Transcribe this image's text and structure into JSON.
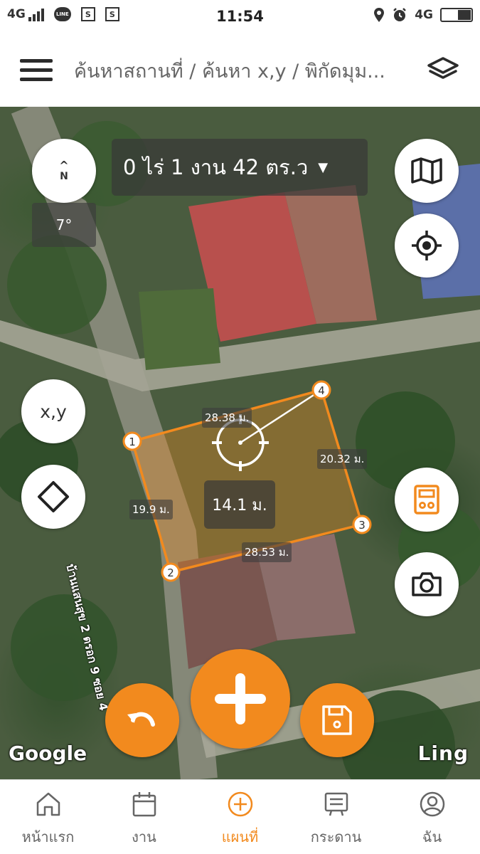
{
  "status_bar": {
    "network_left": "4G",
    "line_label": "LINE",
    "s_icon": "S",
    "time": "11:54",
    "network_right": "4G"
  },
  "header": {
    "title": "ค้นหาสถานที่ / ค้นหา x,y / พิกัดมุม...",
    "menu_icon": "hamburger-icon",
    "layers_icon": "layers-icon"
  },
  "map": {
    "compass_arrow": "^",
    "compass_label": "N",
    "rotation": "7°",
    "area": "0 ไร่ 1 งาน 42 ตร.ว",
    "xy_button": "x,y",
    "edges": [
      "28.38 ม.",
      "20.32 ม.",
      "28.53 ม.",
      "19.9 ม."
    ],
    "center_distance": "14.1 ม.",
    "corner_points": [
      "1",
      "2",
      "3",
      "4"
    ],
    "road_name": "บ้านแสนสุข 2 ตรอก 9 ซอย 4",
    "google_attribution": "Google",
    "provider_logo": "Ling",
    "accent_color": "#F28A1E"
  },
  "bottom_nav": {
    "items": [
      {
        "label": "หน้าแรก",
        "icon": "home-icon",
        "active": false
      },
      {
        "label": "งาน",
        "icon": "clipboard-icon",
        "active": false
      },
      {
        "label": "แผนที่",
        "icon": "plus-circle-icon",
        "active": true
      },
      {
        "label": "กระดาน",
        "icon": "board-icon",
        "active": false
      },
      {
        "label": "ฉัน",
        "icon": "user-icon",
        "active": false
      }
    ]
  }
}
